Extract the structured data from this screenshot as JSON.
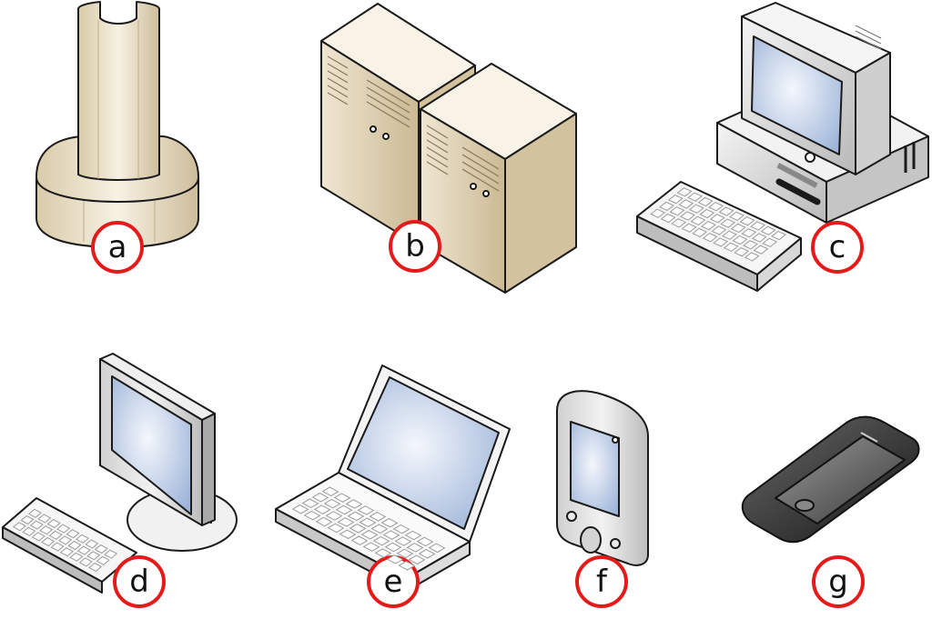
{
  "devices": [
    {
      "label": "a",
      "name": "mainframe"
    },
    {
      "label": "b",
      "name": "servers"
    },
    {
      "label": "c",
      "name": "desktop-pc"
    },
    {
      "label": "d",
      "name": "lcd-workstation"
    },
    {
      "label": "e",
      "name": "laptop"
    },
    {
      "label": "f",
      "name": "pda"
    },
    {
      "label": "g",
      "name": "smartphone"
    }
  ],
  "colors": {
    "badge_ring": "#e41b1b",
    "badge_fill": "#ffffff",
    "outline": "#1a1a1a",
    "beige": "#ece3cf",
    "beige_dark": "#cdbd9a",
    "grey": "#dcdcdc",
    "grey_dark": "#a9a9a9",
    "screen": "#c9d8ef",
    "phone_body": "#2a2a2a"
  }
}
